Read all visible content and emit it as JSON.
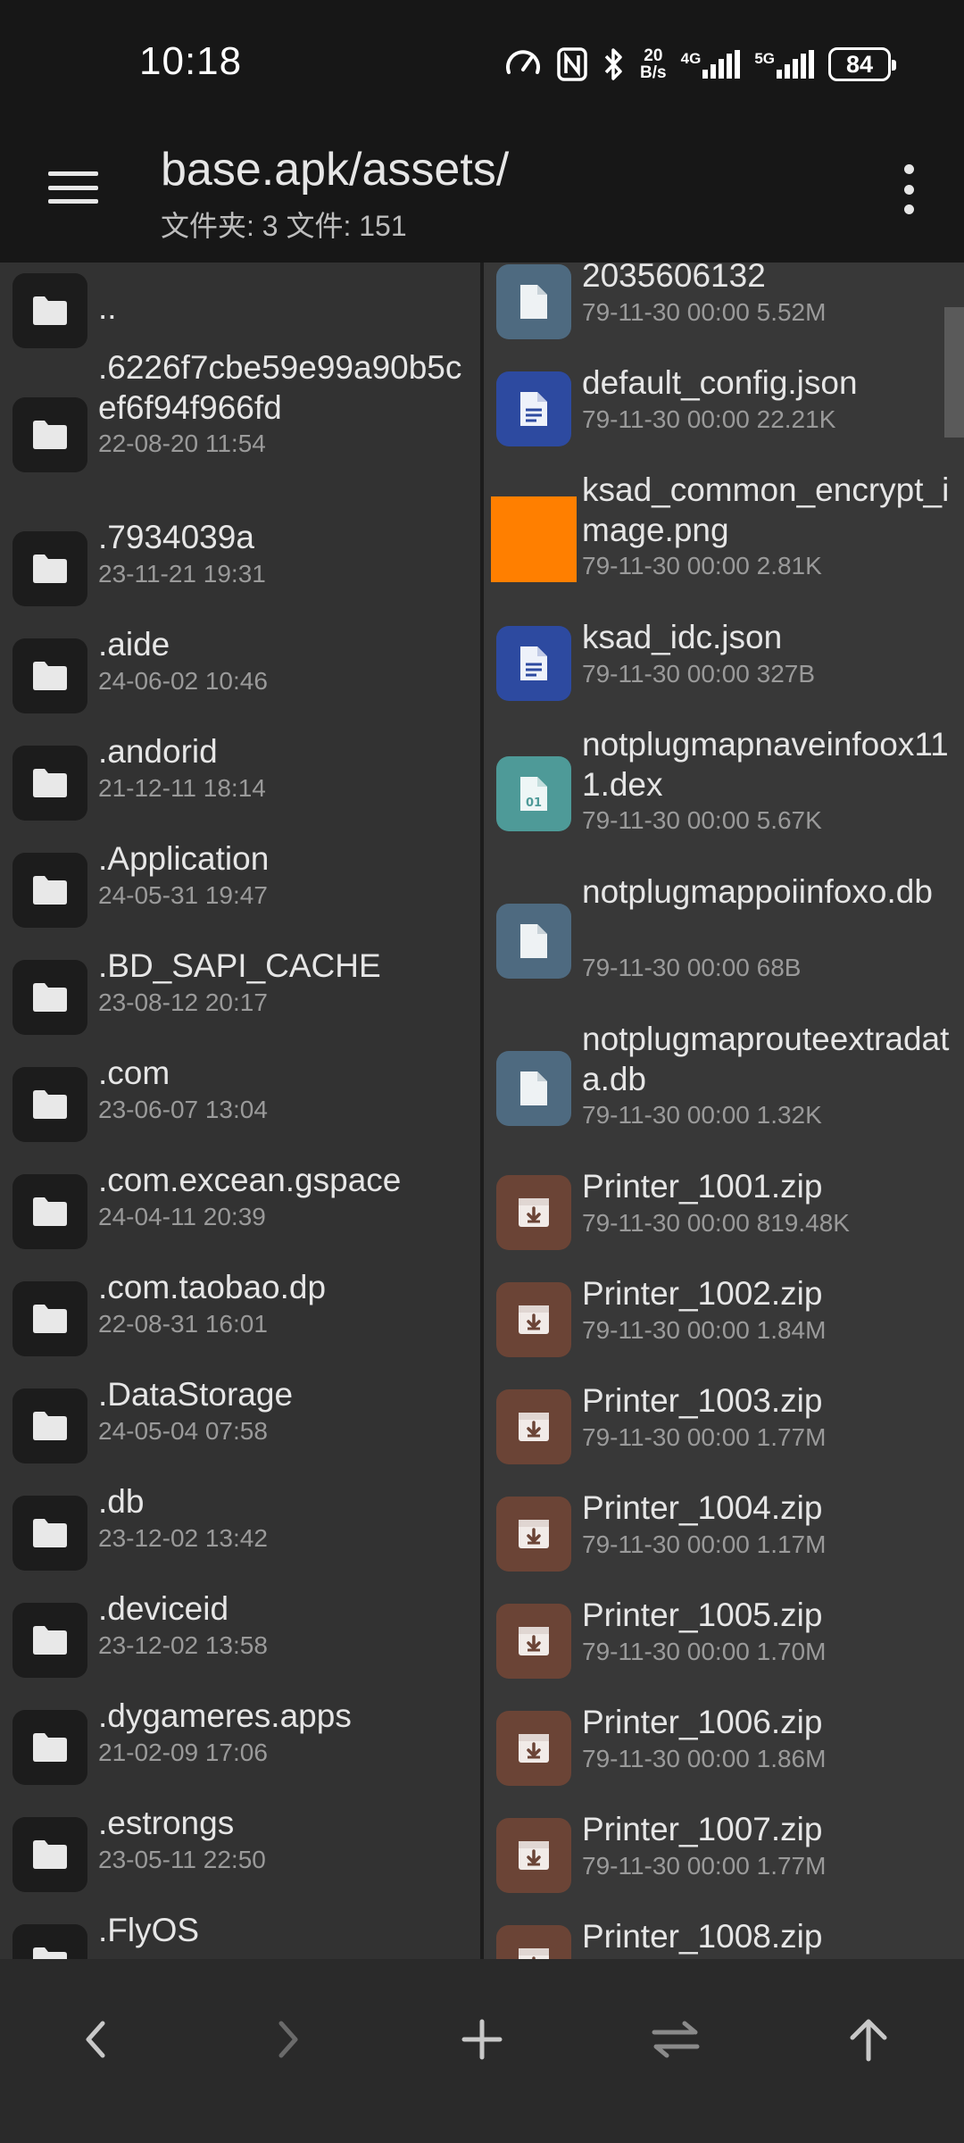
{
  "status_bar": {
    "time": "10:18",
    "net_speed_value": "20",
    "net_speed_unit": "B/s",
    "sim1_label": "4G",
    "sim2_label": "5G",
    "battery": "84"
  },
  "app_bar": {
    "title": "base.apk/assets/",
    "subtitle": "文件夹: 3  文件: 151"
  },
  "left_pane": {
    "items": [
      {
        "name": "..",
        "meta": ""
      },
      {
        "name": ".6226f7cbe59e99a90b5cef6f94f966fd",
        "meta": "22-08-20 11:54"
      },
      {
        "name": ".7934039a",
        "meta": "23-11-21 19:31"
      },
      {
        "name": ".aide",
        "meta": "24-06-02 10:46"
      },
      {
        "name": ".andorid",
        "meta": "21-12-11 18:14"
      },
      {
        "name": ".Application",
        "meta": "24-05-31 19:47"
      },
      {
        "name": ".BD_SAPI_CACHE",
        "meta": "23-08-12 20:17"
      },
      {
        "name": ".com",
        "meta": "23-06-07 13:04"
      },
      {
        "name": ".com.excean.gspace",
        "meta": "24-04-11 20:39"
      },
      {
        "name": ".com.taobao.dp",
        "meta": "22-08-31 16:01"
      },
      {
        "name": ".DataStorage",
        "meta": "24-05-04 07:58"
      },
      {
        "name": ".db",
        "meta": "23-12-02 13:42"
      },
      {
        "name": ".deviceid",
        "meta": "23-12-02 13:58"
      },
      {
        "name": ".dygameres.apps",
        "meta": "21-02-09 17:06"
      },
      {
        "name": ".estrongs",
        "meta": "23-05-11 22:50"
      },
      {
        "name": ".FlyOS",
        "meta": ""
      }
    ]
  },
  "right_pane": {
    "items": [
      {
        "name": "2035606132",
        "meta": "79-11-30 00:00  5.52M",
        "icon": "generic-file-icon",
        "color": "#4e6a80"
      },
      {
        "name": "default_config.json",
        "meta": "79-11-30 00:00  22.21K",
        "icon": "document-icon",
        "color": "#2d4aa0"
      },
      {
        "name": "ksad_common_encrypt_image.png",
        "meta": "79-11-30 00:00  2.81K",
        "icon": "image-thumbnail",
        "color": "#ff7f00"
      },
      {
        "name": "ksad_idc.json",
        "meta": "79-11-30 00:00  327B",
        "icon": "document-icon",
        "color": "#2d4aa0"
      },
      {
        "name": "notplugmapnaveinfoox111.dex",
        "meta": "79-11-30 00:00  5.67K",
        "icon": "binary-file-icon",
        "color": "#4e9a98"
      },
      {
        "name": "notplugmappoiinfoxo.db",
        "meta": "79-11-30 00:00  68B",
        "icon": "generic-file-icon",
        "color": "#4e6a80"
      },
      {
        "name": "notplugmaprouteextradata.db",
        "meta": "79-11-30 00:00  1.32K",
        "icon": "generic-file-icon",
        "color": "#4e6a80"
      },
      {
        "name": "Printer_1001.zip",
        "meta": "79-11-30 00:00  819.48K",
        "icon": "archive-icon",
        "color": "#6b4436"
      },
      {
        "name": "Printer_1002.zip",
        "meta": "79-11-30 00:00  1.84M",
        "icon": "archive-icon",
        "color": "#6b4436"
      },
      {
        "name": "Printer_1003.zip",
        "meta": "79-11-30 00:00  1.77M",
        "icon": "archive-icon",
        "color": "#6b4436"
      },
      {
        "name": "Printer_1004.zip",
        "meta": "79-11-30 00:00  1.17M",
        "icon": "archive-icon",
        "color": "#6b4436"
      },
      {
        "name": "Printer_1005.zip",
        "meta": "79-11-30 00:00  1.70M",
        "icon": "archive-icon",
        "color": "#6b4436"
      },
      {
        "name": "Printer_1006.zip",
        "meta": "79-11-30 00:00  1.86M",
        "icon": "archive-icon",
        "color": "#6b4436"
      },
      {
        "name": "Printer_1007.zip",
        "meta": "79-11-30 00:00  1.77M",
        "icon": "archive-icon",
        "color": "#6b4436"
      },
      {
        "name": "Printer_1008.zip",
        "meta": "",
        "icon": "archive-icon",
        "color": "#6b4436"
      }
    ]
  },
  "bottom_bar": {
    "buttons": [
      "back-arrow-icon",
      "forward-arrow-icon",
      "plus-icon",
      "swap-icon",
      "up-arrow-icon"
    ]
  },
  "colors": {
    "folder_bg": "#1c1c1c",
    "left_pane_bg": "#323232",
    "right_pane_bg": "#383838",
    "toolbar_bg": "#171717"
  }
}
